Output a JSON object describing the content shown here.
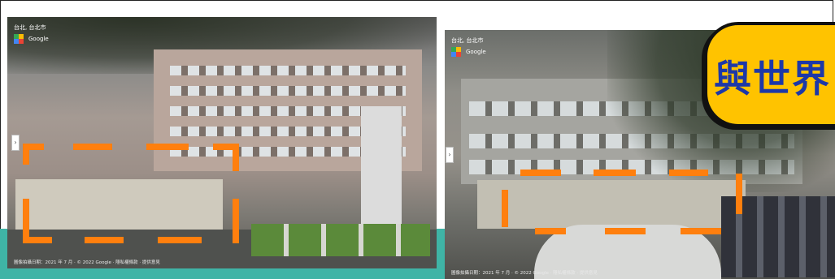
{
  "left_view": {
    "location": "台北, 台北市",
    "brand": "Google",
    "footer": "圖像拍攝日期：2021 年 7 月 · © 2022 Google · 隱私權條款 · 提供意見"
  },
  "right_view": {
    "location": "台北, 台北市",
    "brand": "Google",
    "footer": "圖像拍攝日期：2021 年 7 月 · © 2022 Google · 隱私權條款 · 提供意見"
  },
  "callout": {
    "text": "與世界"
  },
  "colors": {
    "teal_band": "#3fb4a6",
    "dash_highlight": "#ff7f0e",
    "callout_fill": "#ffc300",
    "callout_text": "#1d38a8"
  }
}
